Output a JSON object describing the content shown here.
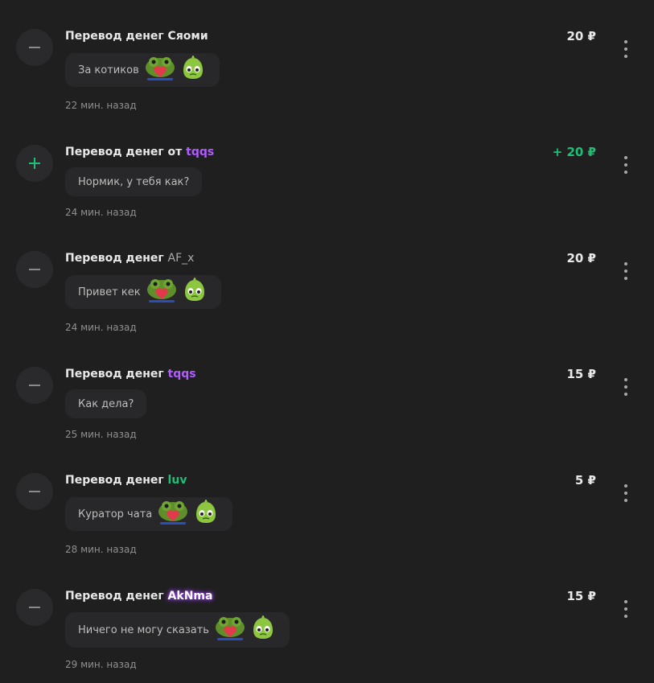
{
  "colors": {
    "background": "#1f1f20",
    "income_amount": "#1fbf75",
    "plus_icon": "#1fbf75",
    "minus_icon": "#8a8a8a"
  },
  "transfers": [
    {
      "direction": "outgoing",
      "icon": "minus-icon",
      "title_prefix": "Перевод денег",
      "sender": "Сяоми",
      "sender_color": "#e8e8e8",
      "sender_glow": false,
      "amount": "20 ₽",
      "message": "За котиков",
      "stickers": [
        "frog-heart-sticker",
        "green-blob-sticker"
      ],
      "time": "22 мин. назад"
    },
    {
      "direction": "incoming",
      "icon": "plus-icon",
      "title_prefix": "Перевод денег от",
      "sender": "tqqs",
      "sender_color": "#b15cff",
      "sender_glow": false,
      "amount": "+ 20 ₽",
      "message": "Нормик, у тебя как?",
      "stickers": [],
      "time": "24 мин. назад"
    },
    {
      "direction": "outgoing",
      "icon": "minus-icon",
      "title_prefix": "Перевод денег",
      "sender": "AF_x",
      "sender_color": "#a9a9a9",
      "sender_glow": false,
      "amount": "20 ₽",
      "message": "Привет кек",
      "stickers": [
        "frog-heart-sticker",
        "green-blob-sticker"
      ],
      "time": "24 мин. назад"
    },
    {
      "direction": "outgoing",
      "icon": "minus-icon",
      "title_prefix": "Перевод денег",
      "sender": "tqqs",
      "sender_color": "#b15cff",
      "sender_glow": false,
      "amount": "15 ₽",
      "message": "Как дела?",
      "stickers": [],
      "time": "25 мин. назад"
    },
    {
      "direction": "outgoing",
      "icon": "minus-icon",
      "title_prefix": "Перевод денег",
      "sender": "luv",
      "sender_color": "#1fbf75",
      "sender_glow": false,
      "amount": "5 ₽",
      "message": "Куратор чата",
      "stickers": [
        "frog-heart-sticker",
        "green-blob-sticker"
      ],
      "time": "28 мин. назад"
    },
    {
      "direction": "outgoing",
      "icon": "minus-icon",
      "title_prefix": "Перевод денег",
      "sender": "AkNma",
      "sender_color": "#ffffff",
      "sender_glow": true,
      "amount": "15 ₽",
      "message": "Ничего не могу сказать",
      "stickers": [
        "frog-heart-sticker",
        "green-blob-sticker"
      ],
      "time": "29 мин. назад"
    }
  ]
}
